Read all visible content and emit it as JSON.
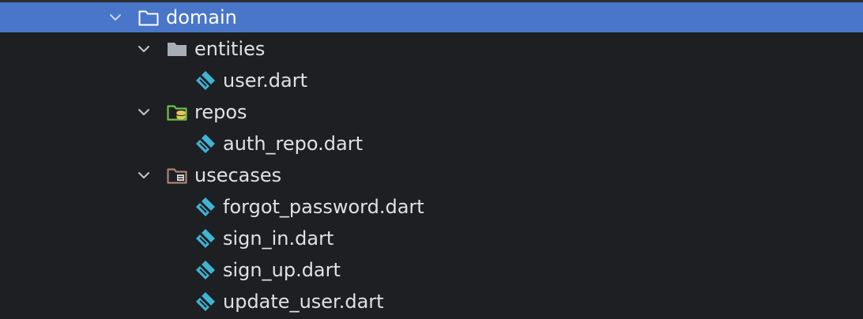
{
  "tree": {
    "root": {
      "label": "domain",
      "icon": "folder-outline-icon",
      "expanded": true,
      "selected": true
    },
    "folders": [
      {
        "label": "entities",
        "icon": "folder-filled-icon",
        "expanded": true,
        "files": [
          {
            "label": "user.dart",
            "icon": "dart-file-icon"
          }
        ]
      },
      {
        "label": "repos",
        "icon": "folder-database-icon",
        "expanded": true,
        "files": [
          {
            "label": "auth_repo.dart",
            "icon": "dart-file-icon"
          }
        ]
      },
      {
        "label": "usecases",
        "icon": "folder-module-icon",
        "expanded": true,
        "files": [
          {
            "label": "forgot_password.dart",
            "icon": "dart-file-icon"
          },
          {
            "label": "sign_in.dart",
            "icon": "dart-file-icon"
          },
          {
            "label": "sign_up.dart",
            "icon": "dart-file-icon"
          },
          {
            "label": "update_user.dart",
            "icon": "dart-file-icon"
          }
        ]
      }
    ]
  },
  "colors": {
    "background": "#1e1f22",
    "selection": "#4a76c9",
    "text": "#dfe1e5",
    "dart_icon": "#3fb4d4",
    "repos_folder": "#6fbf4a",
    "usecases_folder": "#a98477",
    "entities_folder": "#a9adb5"
  }
}
